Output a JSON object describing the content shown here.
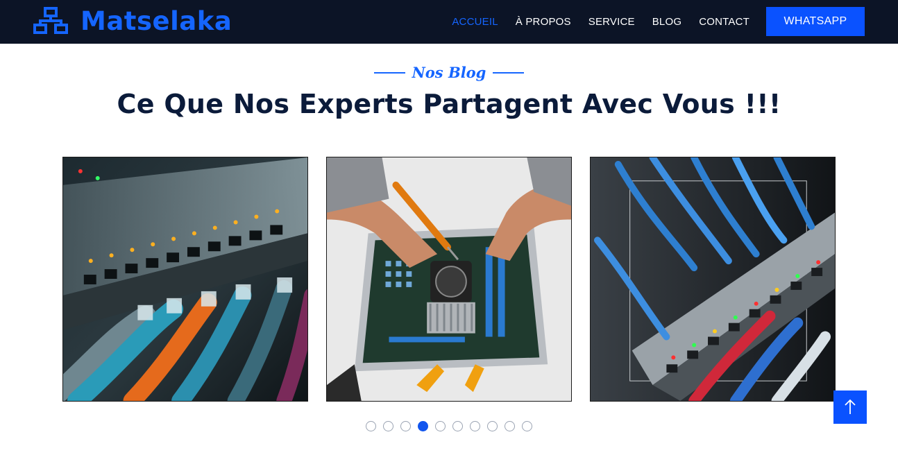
{
  "brand": {
    "name": "Matselaka",
    "icon": "network-icon"
  },
  "nav": {
    "items": [
      {
        "label": "ACCUEIL",
        "active": true
      },
      {
        "label": "À PROPOS",
        "active": false
      },
      {
        "label": "SERVICE",
        "active": false
      },
      {
        "label": "BLOG",
        "active": false
      },
      {
        "label": "CONTACT",
        "active": false
      }
    ],
    "whatsapp_label": "WHATSAPP"
  },
  "section": {
    "eyebrow": "Nos Blog",
    "title": "Ce Que Nos Experts Partagent Avec Vous !!!"
  },
  "cards": [
    {
      "image": "ethernet-switch-cables-image"
    },
    {
      "image": "technician-repairing-motherboard-image"
    },
    {
      "image": "network-patch-panel-image"
    }
  ],
  "carousel": {
    "dot_count": 10,
    "active_dot": 4
  },
  "colors": {
    "navbar": "#0c1426",
    "accent": "#1565ff",
    "button": "#0a52ff",
    "heading": "#0b1b3a"
  },
  "back_to_top": {
    "icon": "arrow-up-icon"
  }
}
